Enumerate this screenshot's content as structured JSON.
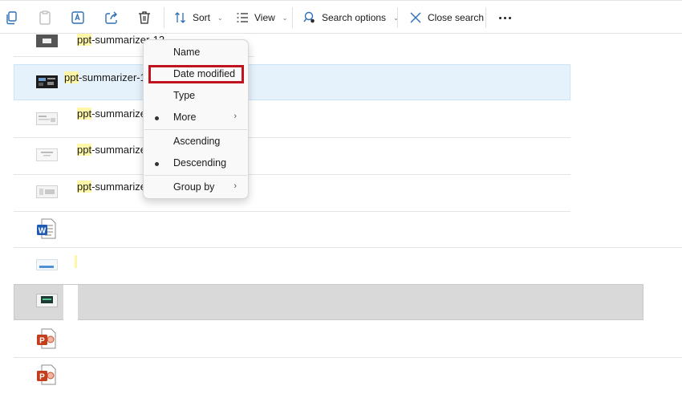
{
  "toolbar": {
    "sort_label": "Sort",
    "view_label": "View",
    "search_options_label": "Search options",
    "close_search_label": "Close search"
  },
  "files": [
    {
      "highlight": "ppt",
      "rest": "-summarizer-12",
      "thumb": "dark-screen-thumbnail"
    },
    {
      "highlight": "ppt",
      "rest": "-summarizer-1",
      "thumb": "dark-dashboard-thumbnail",
      "selected": true
    },
    {
      "highlight": "ppt",
      "rest": "-summarizer-1",
      "thumb": "document-thumbnail"
    },
    {
      "highlight": "ppt",
      "rest": "-summarizer-1",
      "thumb": "document-thumbnail"
    },
    {
      "highlight": "ppt",
      "rest": "-summarizer-1",
      "thumb": "document-thumbnail"
    },
    {
      "thumb": "word-icon"
    },
    {
      "thumb": "document-thumbnail"
    },
    {
      "thumb": "dark-dashboard-thumbnail",
      "grey": true
    },
    {
      "thumb": "powerpoint-icon"
    },
    {
      "thumb": "powerpoint-icon"
    }
  ],
  "sort_menu": {
    "name": "Name",
    "date_modified": "Date modified",
    "type": "Type",
    "more": "More",
    "ascending": "Ascending",
    "descending": "Descending",
    "group_by": "Group by",
    "active_sort": "More",
    "active_order": "Descending",
    "focused_item": "Date modified"
  },
  "colors": {
    "selection": "#e5f1fb",
    "search_highlight": "#fff7a8",
    "focus_outline": "#c1121f"
  }
}
